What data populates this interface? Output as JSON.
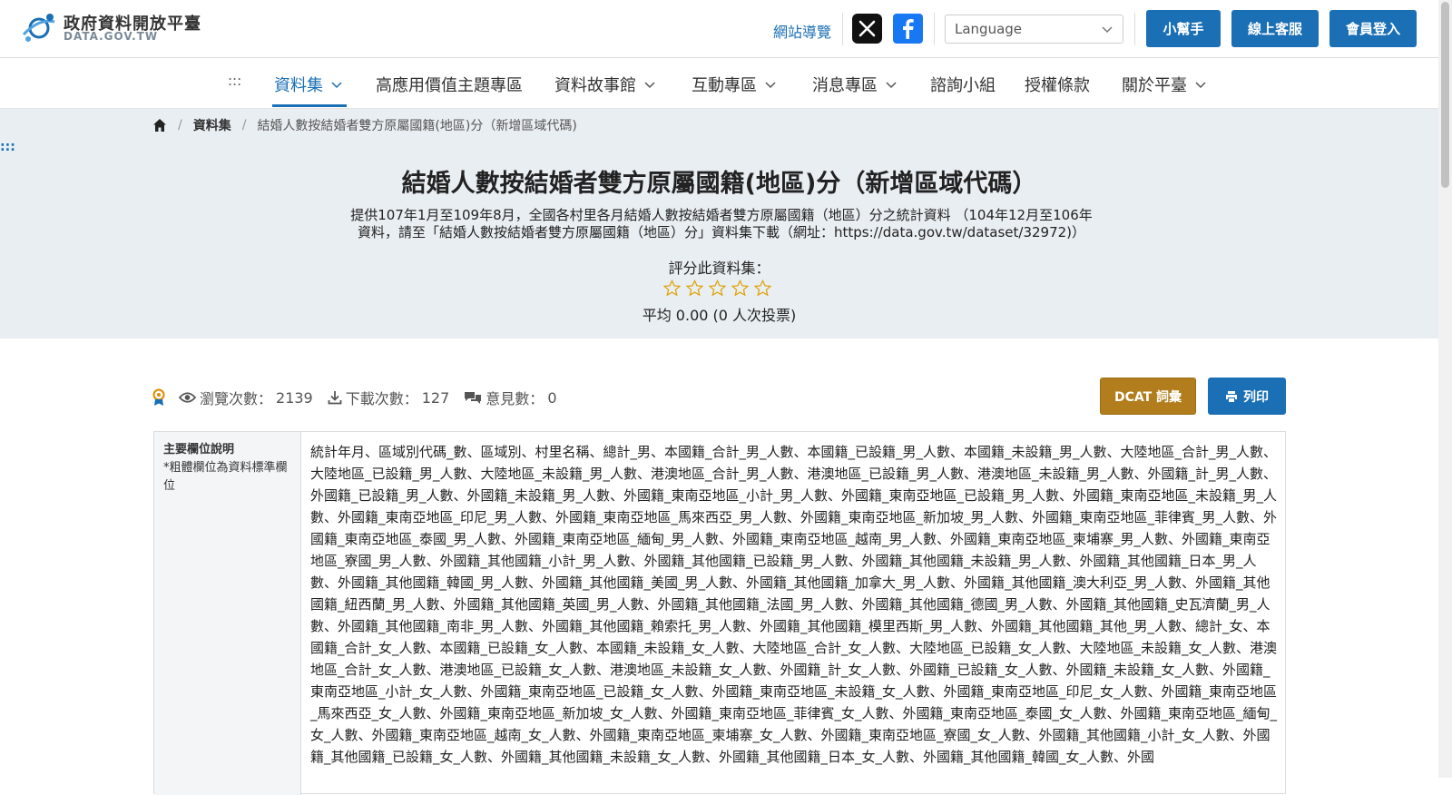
{
  "header": {
    "logo_title": "政府資料開放平臺",
    "logo_sub": "DATA.GOV.TW",
    "site_nav": "網站導覽",
    "language_placeholder": "Language",
    "buttons": {
      "helper": "小幫手",
      "service": "線上客服",
      "login": "會員登入"
    }
  },
  "nav": {
    "dots": ":::",
    "items": [
      "資料集",
      "高應用價值主題專區",
      "資料故事館",
      "互動專區",
      "消息專區",
      "諮詢小組",
      "授權條款",
      "關於平臺"
    ]
  },
  "breadcrumb": {
    "section": "資料集",
    "current": "結婚人數按結婚者雙方原屬國籍(地區)分（新增區域代碼)"
  },
  "left_dots": ":::",
  "dataset": {
    "title": "結婚人數按結婚者雙方原屬國籍(地區)分（新增區域代碼）",
    "description_line1": "提供107年1月至109年8月，全國各村里各月結婚人數按結婚者雙方原屬國籍（地區）分之統計資料 （104年12月至106年",
    "description_line2": "資料，請至「結婚人數按結婚者雙方原屬國籍（地區）分」資料集下載（網址：https://data.gov.tw/dataset/32972)）",
    "rate_label": "評分此資料集：",
    "rating": 0,
    "rating_max": 5,
    "avg_text": "平均 0.00 (0 人次投票)"
  },
  "stats": {
    "views_label": "瀏覽次數：",
    "views": "2139",
    "downloads_label": "下載次數：",
    "downloads": "127",
    "comments_label": "意見數：",
    "comments": "0"
  },
  "actions": {
    "dcat": "DCAT 詞彙",
    "print": "列印"
  },
  "fields": {
    "header_title": "主要欄位說明",
    "header_note": "*粗體欄位為資料標準欄位",
    "content": "統計年月、區域別代碼_數、區域別、村里名稱、總計_男、本國籍_合計_男_人數、本國籍_已設籍_男_人數、本國籍_未設籍_男_人數、大陸地區_合計_男_人數、大陸地區_已設籍_男_人數、大陸地區_未設籍_男_人數、港澳地區_合計_男_人數、港澳地區_已設籍_男_人數、港澳地區_未設籍_男_人數、外國籍_計_男_人數、外國籍_已設籍_男_人數、外國籍_未設籍_男_人數、外國籍_東南亞地區_小計_男_人數、外國籍_東南亞地區_已設籍_男_人數、外國籍_東南亞地區_未設籍_男_人數、外國籍_東南亞地區_印尼_男_人數、外國籍_東南亞地區_馬來西亞_男_人數、外國籍_東南亞地區_新加坡_男_人數、外國籍_東南亞地區_菲律賓_男_人數、外國籍_東南亞地區_泰國_男_人數、外國籍_東南亞地區_緬甸_男_人數、外國籍_東南亞地區_越南_男_人數、外國籍_東南亞地區_柬埔寨_男_人數、外國籍_東南亞地區_寮國_男_人數、外國籍_其他國籍_小計_男_人數、外國籍_其他國籍_已設籍_男_人數、外國籍_其他國籍_未設籍_男_人數、外國籍_其他國籍_日本_男_人數、外國籍_其他國籍_韓國_男_人數、外國籍_其他國籍_美國_男_人數、外國籍_其他國籍_加拿大_男_人數、外國籍_其他國籍_澳大利亞_男_人數、外國籍_其他國籍_紐西蘭_男_人數、外國籍_其他國籍_英國_男_人數、外國籍_其他國籍_法國_男_人數、外國籍_其他國籍_德國_男_人數、外國籍_其他國籍_史瓦濟蘭_男_人數、外國籍_其他國籍_南非_男_人數、外國籍_其他國籍_賴索托_男_人數、外國籍_其他國籍_模里西斯_男_人數、外國籍_其他國籍_其他_男_人數、總計_女、本國籍_合計_女_人數、本國籍_已設籍_女_人數、本國籍_未設籍_女_人數、大陸地區_合計_女_人數、大陸地區_已設籍_女_人數、大陸地區_未設籍_女_人數、港澳地區_合計_女_人數、港澳地區_已設籍_女_人數、港澳地區_未設籍_女_人數、外國籍_計_女_人數、外國籍_已設籍_女_人數、外國籍_未設籍_女_人數、外國籍_東南亞地區_小計_女_人數、外國籍_東南亞地區_已設籍_女_人數、外國籍_東南亞地區_未設籍_女_人數、外國籍_東南亞地區_印尼_女_人數、外國籍_東南亞地區_馬來西亞_女_人數、外國籍_東南亞地區_新加坡_女_人數、外國籍_東南亞地區_菲律賓_女_人數、外國籍_東南亞地區_泰國_女_人數、外國籍_東南亞地區_緬甸_女_人數、外國籍_東南亞地區_越南_女_人數、外國籍_東南亞地區_柬埔寨_女_人數、外國籍_東南亞地區_寮國_女_人數、外國籍_其他國籍_小計_女_人數、外國籍_其他國籍_已設籍_女_人數、外國籍_其他國籍_未設籍_女_人數、外國籍_其他國籍_日本_女_人數、外國籍_其他國籍_韓國_女_人數、外國"
  },
  "colors": {
    "primary": "#1a6fb5",
    "dcat": "#b27e1d",
    "hero_bg": "#e9eef3"
  }
}
